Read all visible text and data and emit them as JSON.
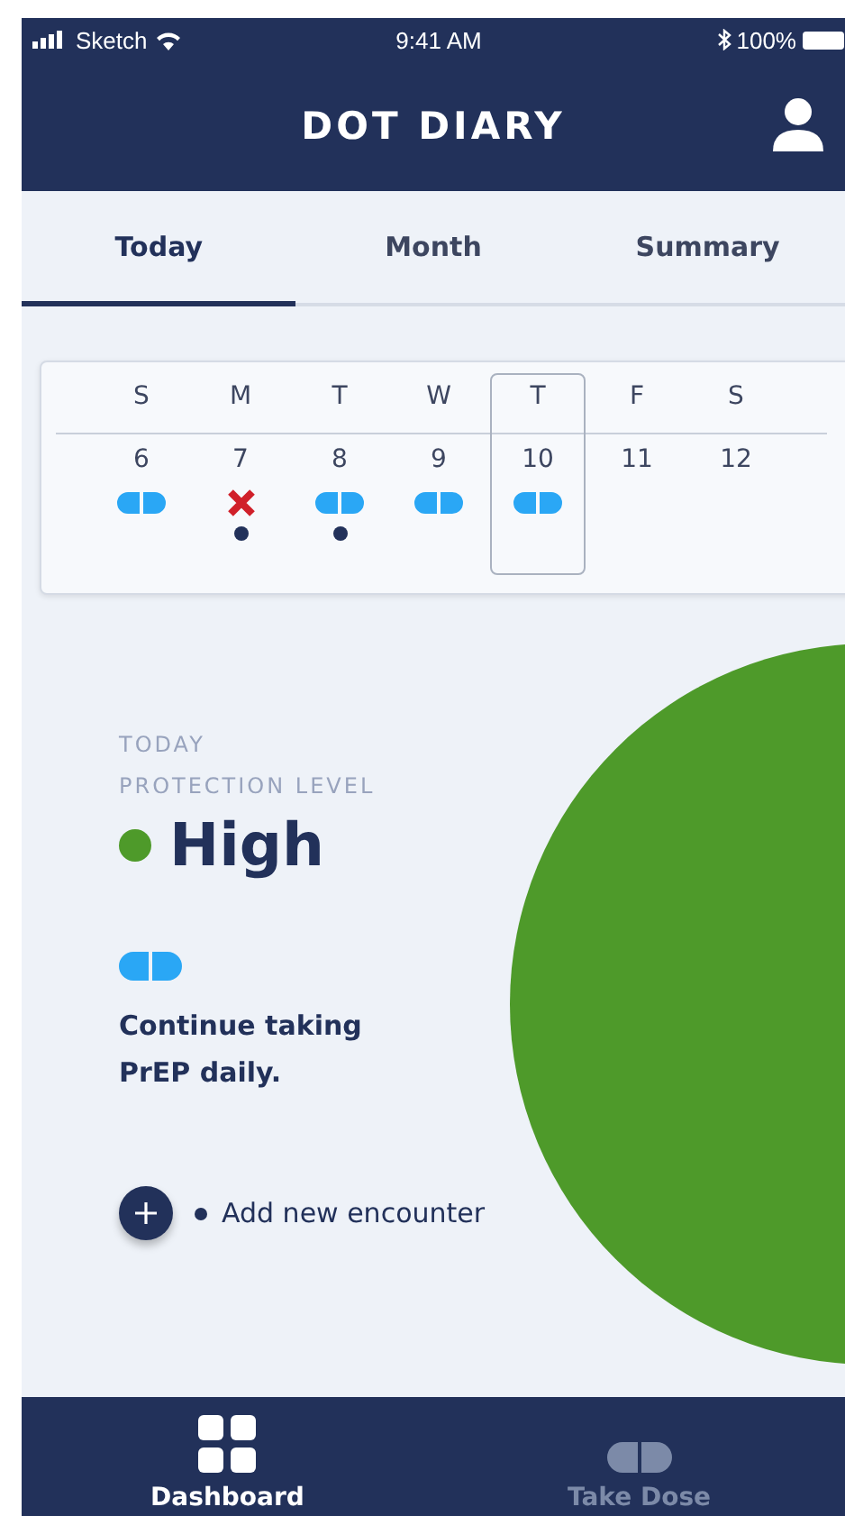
{
  "status_bar": {
    "carrier": "Sketch",
    "time": "9:41 AM",
    "battery": "100%"
  },
  "header": {
    "title": "DOT DIARY"
  },
  "tabs": [
    {
      "label": "Today",
      "selected": true
    },
    {
      "label": "Month",
      "selected": false
    },
    {
      "label": "Summary",
      "selected": false
    }
  ],
  "week": {
    "days": [
      {
        "weekday": "S",
        "date": "6",
        "kind": "taken",
        "encounter": false,
        "selected": false
      },
      {
        "weekday": "M",
        "date": "7",
        "kind": "missed",
        "encounter": true,
        "selected": false
      },
      {
        "weekday": "T",
        "date": "8",
        "kind": "taken",
        "encounter": true,
        "selected": false
      },
      {
        "weekday": "W",
        "date": "9",
        "kind": "taken",
        "encounter": false,
        "selected": false
      },
      {
        "weekday": "T",
        "date": "10",
        "kind": "taken",
        "encounter": false,
        "selected": true
      },
      {
        "weekday": "F",
        "date": "11",
        "kind": "empty",
        "encounter": false,
        "selected": false
      },
      {
        "weekday": "S",
        "date": "12",
        "kind": "empty",
        "encounter": false,
        "selected": false
      }
    ]
  },
  "protection": {
    "eyebrow": "TODAY",
    "label": "PROTECTION LEVEL",
    "value": "High",
    "color": "#4e9a2a"
  },
  "advice": "Continue taking PrEP daily.",
  "add_encounter": {
    "label": "Add new encounter"
  },
  "bottom_nav": [
    {
      "label": "Dashboard",
      "kind": "dashboard",
      "selected": true
    },
    {
      "label": "Take Dose",
      "kind": "dose",
      "selected": false
    }
  ]
}
